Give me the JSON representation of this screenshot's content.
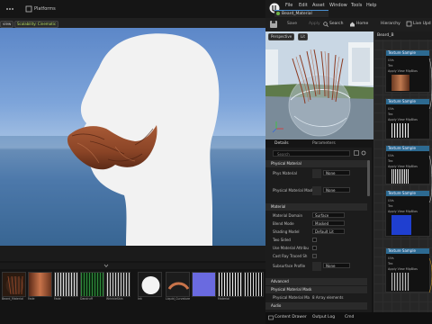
{
  "viewport": {
    "menu_left": "...",
    "platforms_label": "Platforms",
    "view_pill": "view",
    "scalability_pill": "Scalability: Cinematic"
  },
  "appbar": {
    "menu": [
      "File",
      "Edit",
      "Asset",
      "Window",
      "Tools",
      "Help"
    ],
    "asset_tab": "Beard_Material",
    "toolbar": {
      "save": "Save",
      "apply": "Apply",
      "search": "Search",
      "home": "Home",
      "hierarchy": "Hierarchy",
      "live_update": "Live Upd"
    },
    "graph_tab": "Beard_B"
  },
  "preview": {
    "mode": "Perspective",
    "lit": "Lit"
  },
  "details": {
    "tab_details": "Details",
    "tab_parameters": "Parameters",
    "search_placeholder": "Search",
    "sections": {
      "physical_material": "Physical Material",
      "material": "Material",
      "physical_material_mask": "Physical Material Mask",
      "advanced": "Advanced",
      "audio": "Audio"
    },
    "rows": {
      "phys_material": {
        "label": "Phys Material",
        "value": "None"
      },
      "phys_material_mask": {
        "label": "Physical Material Mask",
        "value": "None"
      },
      "material_domain": {
        "label": "Material Domain",
        "value": "Surface"
      },
      "blend_mode": {
        "label": "Blend Mode",
        "value": "Masked"
      },
      "shading_model": {
        "label": "Shading Model",
        "value": "Default Lit"
      },
      "two_sided": {
        "label": "Two Sided"
      },
      "use_material_attributes": {
        "label": "Use Material Attribu"
      },
      "cast_ray_traced": {
        "label": "Cast Ray Traced Sh"
      },
      "subsurface_profile": {
        "label": "Subsurface Profile",
        "value": "None"
      },
      "phys_material_mask_array": {
        "label": "Physical Material Ma",
        "value": "8 Array elements"
      }
    }
  },
  "graph": {
    "nodes": [
      {
        "title": "Texture Sample",
        "pins": [
          "UVs",
          "Tex",
          "Apply View MipBias"
        ]
      },
      {
        "title": "Texture Sample",
        "pins": [
          "UVs",
          "Tex",
          "Apply View MipBias"
        ]
      },
      {
        "title": "Texture Sample",
        "pins": [
          "UVs",
          "Tex",
          "Apply View MipBias"
        ]
      },
      {
        "title": "Texture Sample",
        "pins": [
          "UVs",
          "Tex",
          "Apply View MipBias"
        ]
      },
      {
        "title": "Texture Sample",
        "pins": [
          "UVs",
          "Tex",
          "Apply View MipBias"
        ]
      }
    ]
  },
  "content_browser": {
    "items": [
      "Beard_Material",
      "Fade",
      "Fade",
      "Dandruff",
      "WrinkleSkin",
      "Ink",
      "Liquid_Curvature",
      "",
      "Material",
      "",
      ""
    ]
  },
  "statusbar": {
    "content_drawer": "Content Drawer",
    "output_log": "Output Log",
    "cmd": "Cmd"
  }
}
